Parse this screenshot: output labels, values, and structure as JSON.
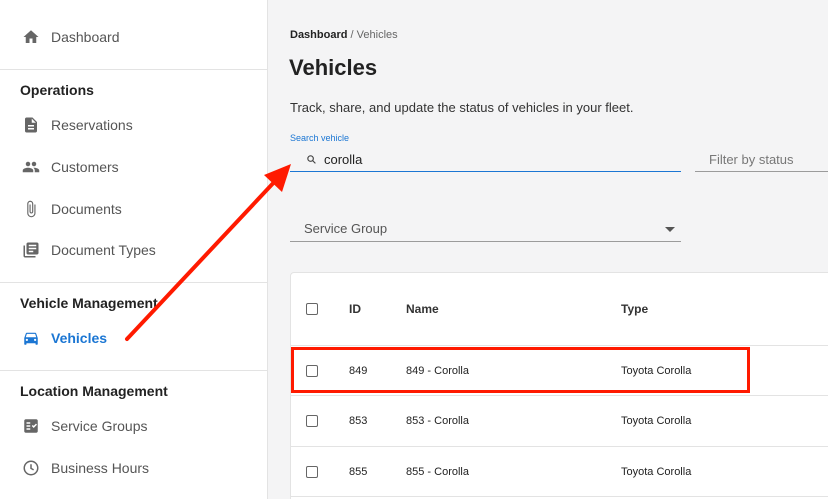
{
  "sidebar": {
    "top_items": [
      {
        "label": "Dashboard",
        "icon": "home-icon"
      }
    ],
    "sections": [
      {
        "title": "Operations",
        "items": [
          {
            "label": "Reservations",
            "icon": "document-icon"
          },
          {
            "label": "Customers",
            "icon": "people-icon"
          },
          {
            "label": "Documents",
            "icon": "paperclip-icon"
          },
          {
            "label": "Document Types",
            "icon": "library-icon"
          }
        ]
      },
      {
        "title": "Vehicle Management",
        "items": [
          {
            "label": "Vehicles",
            "icon": "car-icon",
            "active": true
          }
        ]
      },
      {
        "title": "Location Management",
        "items": [
          {
            "label": "Service Groups",
            "icon": "checklist-icon"
          },
          {
            "label": "Business Hours",
            "icon": "clock-icon"
          }
        ]
      }
    ]
  },
  "breadcrumb": {
    "root": "Dashboard",
    "separator": "/",
    "current": "Vehicles"
  },
  "page": {
    "title": "Vehicles",
    "description": "Track, share, and update the status of vehicles in your fleet."
  },
  "search": {
    "label": "Search vehicle",
    "value": "corolla",
    "icon": "search-icon"
  },
  "filter_status": {
    "placeholder": "Filter by status"
  },
  "service_group": {
    "placeholder": "Service Group"
  },
  "table": {
    "columns": [
      "ID",
      "Name",
      "Type"
    ],
    "rows": [
      {
        "id": "849",
        "name": "849 - Corolla",
        "type": "Toyota Corolla"
      },
      {
        "id": "853",
        "name": "853 - Corolla",
        "type": "Toyota Corolla"
      },
      {
        "id": "855",
        "name": "855 - Corolla",
        "type": "Toyota Corolla"
      }
    ]
  },
  "colors": {
    "accent": "#1b76d3",
    "annotation": "#ff1a00"
  }
}
